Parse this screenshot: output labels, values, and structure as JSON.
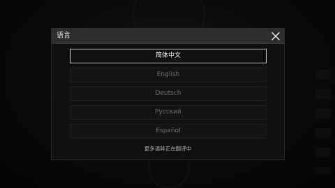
{
  "dialog": {
    "title": "语言",
    "close_icon": "close-x-icon",
    "languages": [
      {
        "label": "简体中文",
        "selected": true
      },
      {
        "label": "English",
        "selected": false
      },
      {
        "label": "Deutsch",
        "selected": false
      },
      {
        "label": "Русский",
        "selected": false
      },
      {
        "label": "Español",
        "selected": false
      }
    ],
    "note": "更多语种正在翻译中"
  },
  "colors": {
    "header_bg": "#2e2e2e",
    "selected_border": "#c9c9c9",
    "unselected_text": "#6d6d6d"
  }
}
